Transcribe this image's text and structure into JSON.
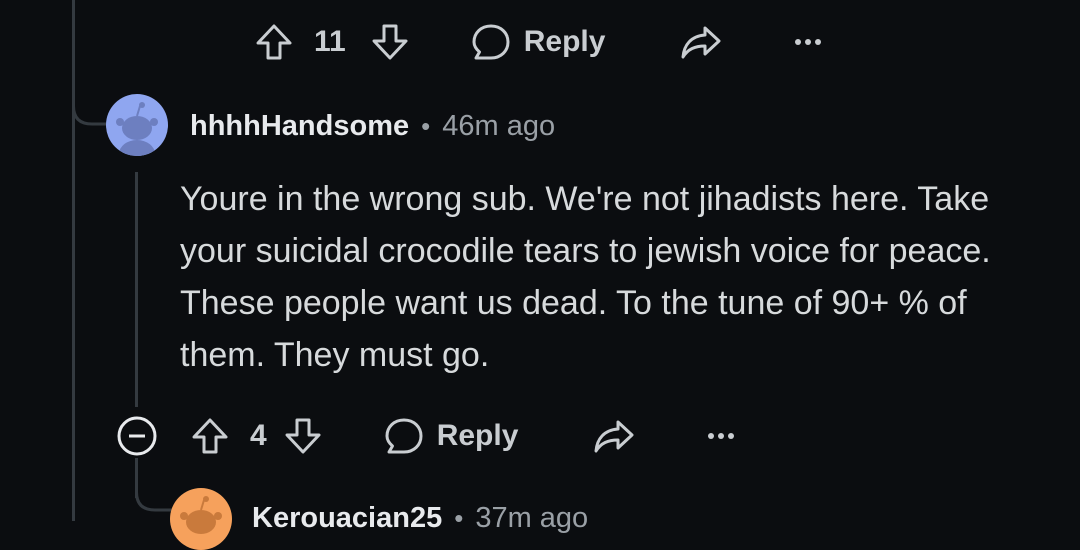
{
  "top_actions": {
    "upvotes": "11",
    "reply_label": "Reply"
  },
  "comment": {
    "username": "hhhhHandsome",
    "separator": "•",
    "timestamp": "46m ago",
    "body": "Youre in the wrong sub. We're not jihadists here. Take your suicidal crocodile tears to jewish voice for peace. These people want us dead. To the tune of 90+ % of them. They must go.",
    "upvotes": "4",
    "reply_label": "Reply"
  },
  "child_comment": {
    "username": "Kerouacian25",
    "separator": "•",
    "timestamp": "37m ago"
  },
  "colors": {
    "background": "#0b0d10",
    "thread_line": "#343a40",
    "avatar_blue": "#8fa6f0",
    "avatar_orange": "#f6a15c"
  }
}
